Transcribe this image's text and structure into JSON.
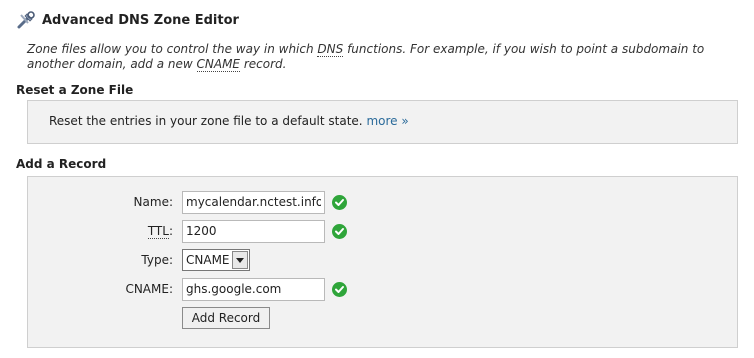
{
  "header": {
    "title": "Advanced DNS Zone Editor",
    "icon": "tools-icon"
  },
  "intro": {
    "part1": "Zone files allow you to control the way in which ",
    "dns_abbr": "DNS",
    "part2": " functions. For example, if you wish to point a subdomain to another domain, add a new ",
    "cname_abbr": "CNAME",
    "part3": " record."
  },
  "reset": {
    "heading": "Reset a Zone File",
    "text": "Reset the entries in your zone file to a default state.",
    "more_link": "more »"
  },
  "add": {
    "heading": "Add a Record",
    "name_label": "Name:",
    "name_value": "mycalendar.nctest.info.",
    "ttl_label_abbr": "TTL",
    "ttl_label_colon": ":",
    "ttl_value": "1200",
    "type_label": "Type:",
    "type_value": "CNAME",
    "cname_label": "CNAME:",
    "cname_value": "ghs.google.com",
    "submit_label": "Add Record"
  },
  "colors": {
    "valid": "#2fa53a",
    "link": "#2a6a9a",
    "panel": "#f2f2f2"
  }
}
